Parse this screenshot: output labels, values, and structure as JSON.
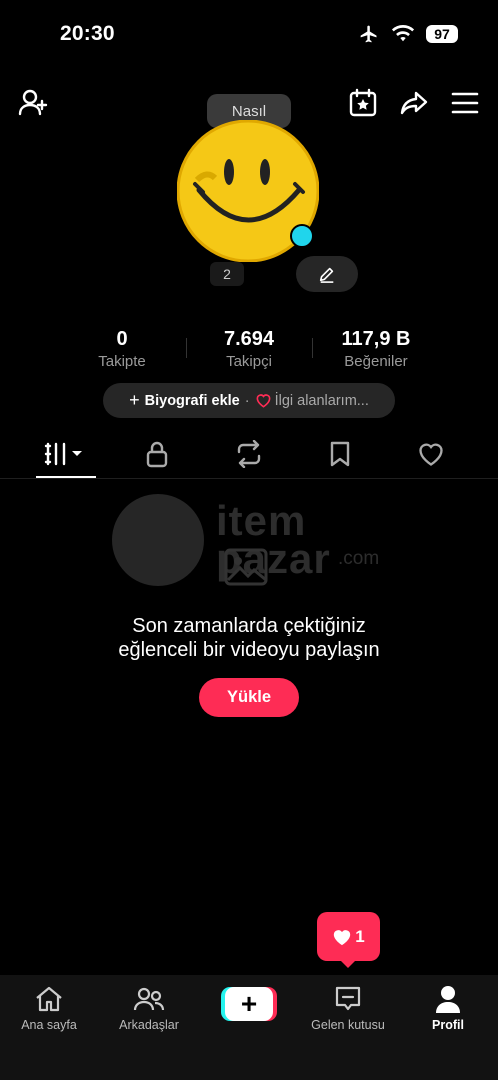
{
  "status_bar": {
    "time": "20:30",
    "battery": "97"
  },
  "profile": {
    "nasil_label": "Nasıl",
    "username_hint": "2"
  },
  "stats": [
    {
      "value": "0",
      "label": "Takipte"
    },
    {
      "value": "7.694",
      "label": "Takipçi"
    },
    {
      "value": "117,9 B",
      "label": "Beğeniler"
    }
  ],
  "bio": {
    "add_bio": "Biyografi ekle",
    "separator": "·",
    "interests": "İlgi alanlarım..."
  },
  "empty_state": {
    "line1": "Son zamanlarda çektiğiniz",
    "line2": "eğlenceli bir videoyu paylaşın",
    "button": "Yükle"
  },
  "watermark": {
    "line1": "item",
    "line2": "pazar",
    "suffix": ".com"
  },
  "notification": {
    "count": "1"
  },
  "bottom_nav": [
    {
      "label": "Ana sayfa",
      "icon": "home-icon"
    },
    {
      "label": "Arkadaşlar",
      "icon": "friends-icon"
    },
    {
      "label": "",
      "icon": "plus-icon"
    },
    {
      "label": "Gelen kutusu",
      "icon": "inbox-icon"
    },
    {
      "label": "Profil",
      "icon": "profile-icon"
    }
  ],
  "colors": {
    "accent": "#fe2c55",
    "cyan": "#25f4ee",
    "background": "#000000"
  }
}
